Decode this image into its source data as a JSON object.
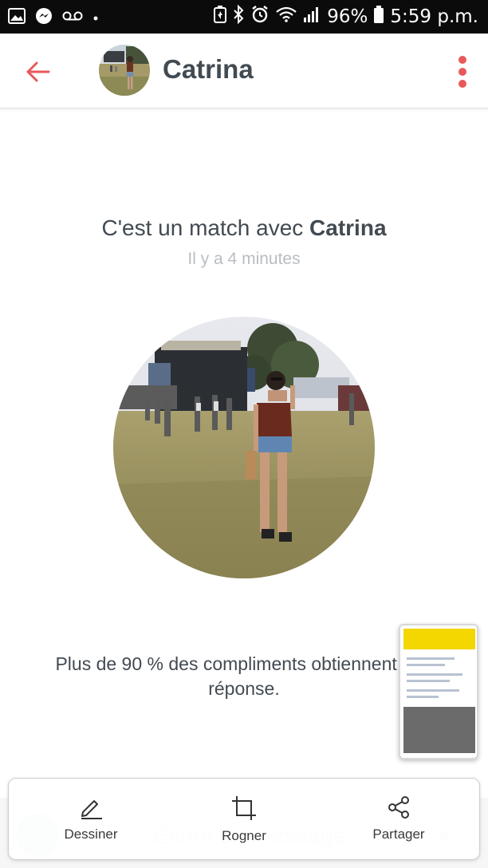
{
  "status_bar": {
    "battery": "96%",
    "time": "5:59 p.m.",
    "icons": [
      "gallery-icon",
      "messenger-icon",
      "voicemail-icon",
      "dot-icon",
      "battery-saver-icon",
      "bluetooth-icon",
      "alarm-icon",
      "wifi-icon",
      "signal-icon",
      "battery-icon"
    ]
  },
  "header": {
    "name": "Catrina",
    "back_icon": "arrow-left-icon",
    "menu_icon": "more-vertical-icon",
    "accent_color": "#e8585b"
  },
  "match": {
    "prefix": "C'est un match avec ",
    "name": "Catrina",
    "time_ago": "Il y a 4 minutes"
  },
  "tip": {
    "text": "Plus de 90 % des compliments obtiennent une réponse."
  },
  "composer": {
    "placeholder": "Écrire un message",
    "gif_icon": "gif-sticker-icon",
    "send_icon": "send-icon"
  },
  "toolbar": {
    "draw_label": "Dessiner",
    "crop_label": "Rogner",
    "share_label": "Partager"
  }
}
